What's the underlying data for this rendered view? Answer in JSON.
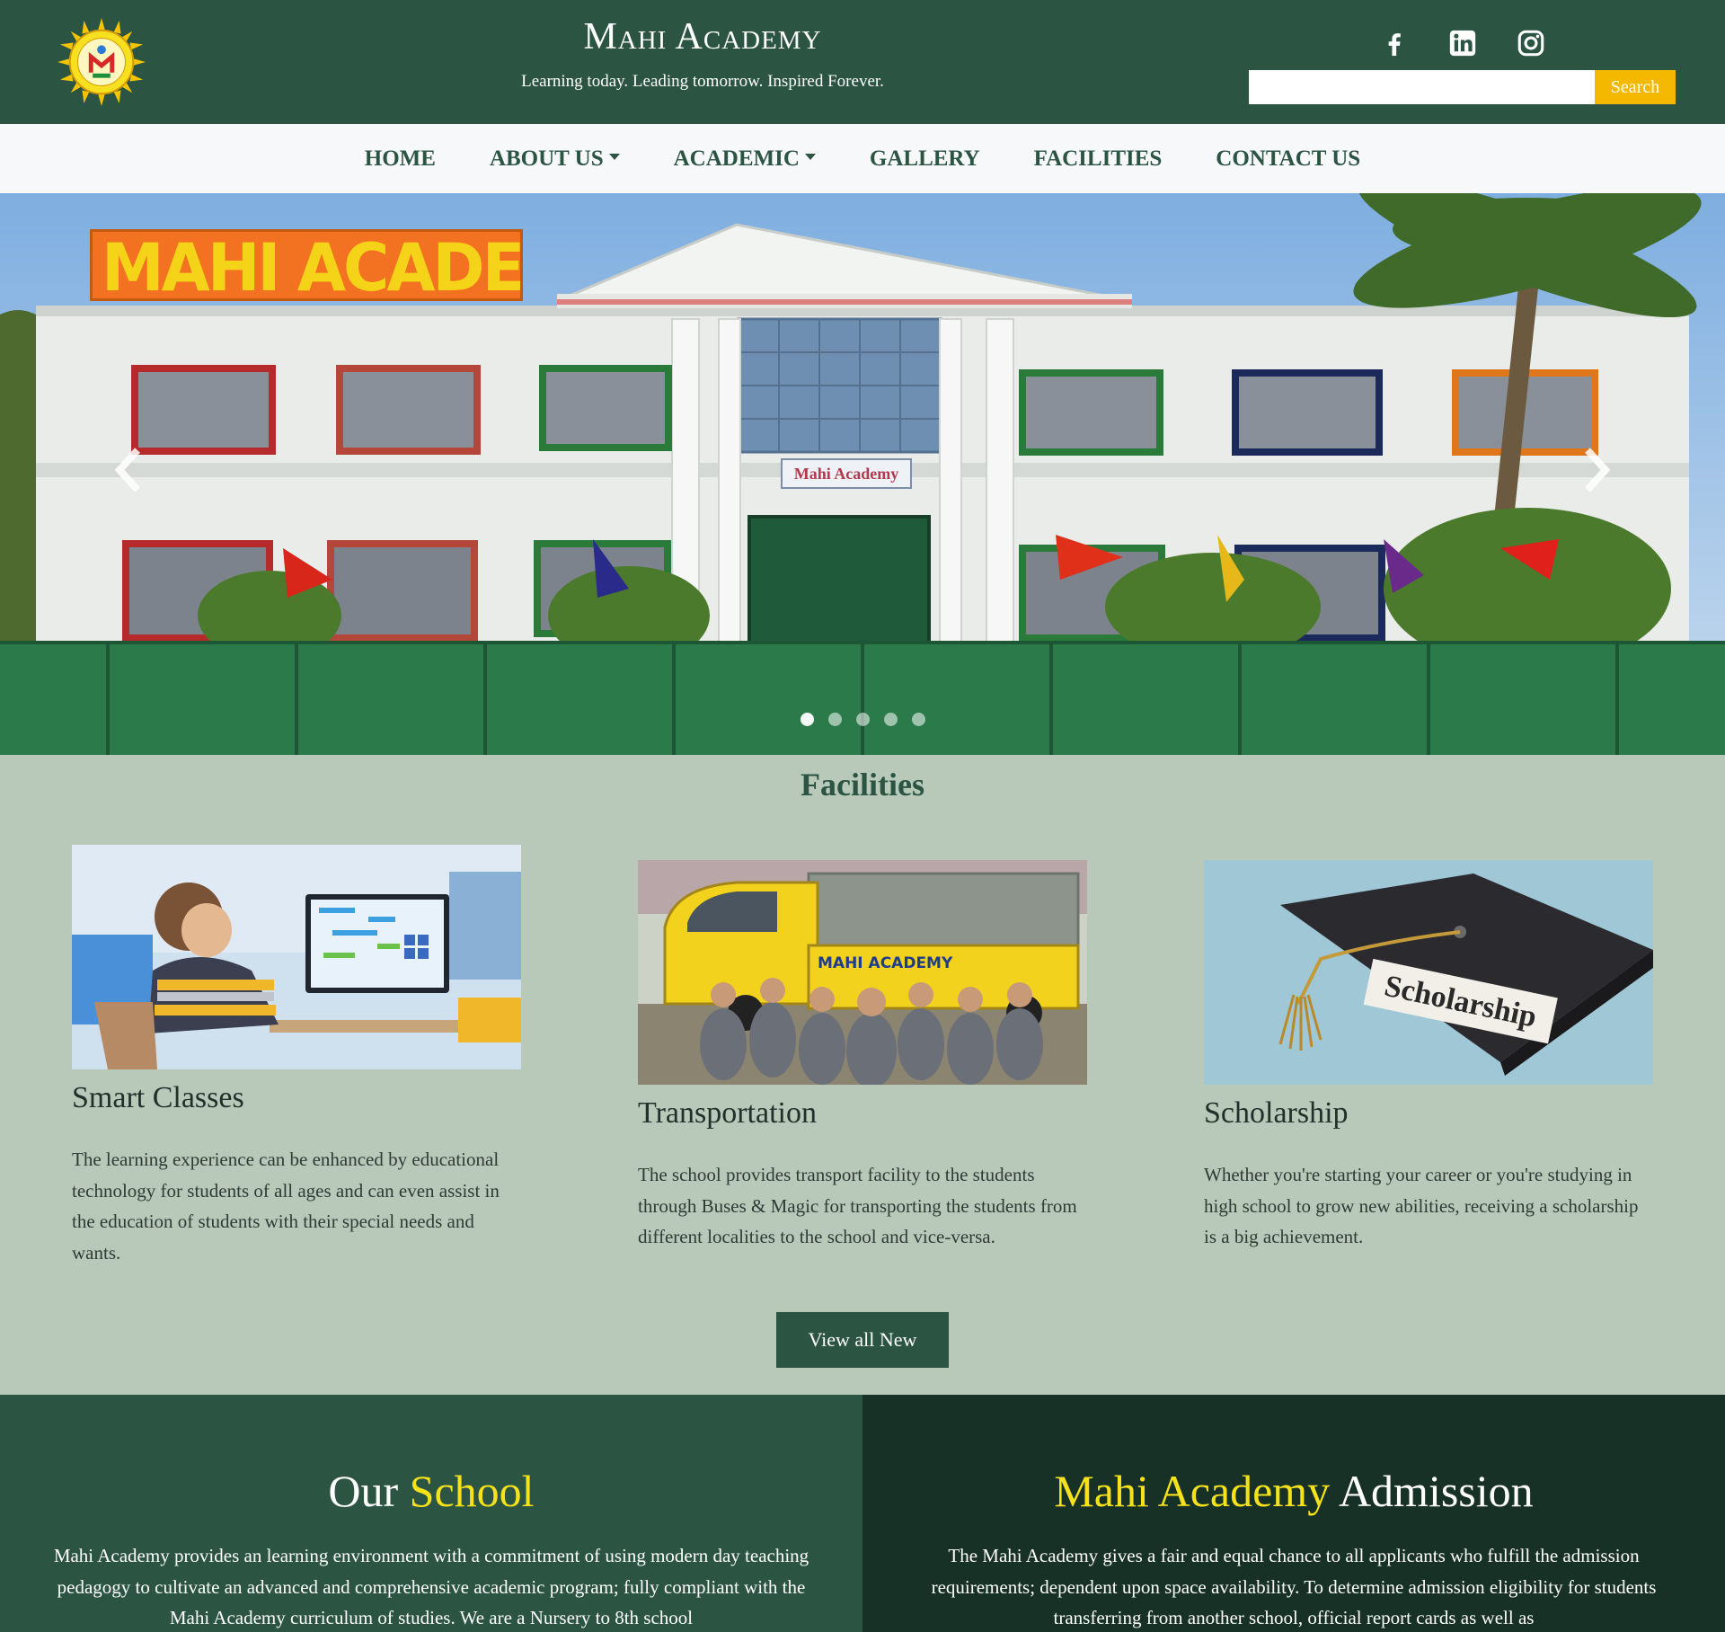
{
  "header": {
    "title": "Mahi Academy",
    "tagline": "Learning today. Leading tomorrow. Inspired Forever.",
    "logo_text": "MAHI ACADEMY",
    "socials": [
      {
        "icon": "facebook-icon"
      },
      {
        "icon": "linkedin-icon"
      },
      {
        "icon": "instagram-icon"
      }
    ],
    "search": {
      "placeholder": "",
      "button_label": "Search"
    }
  },
  "nav": {
    "items": [
      {
        "label": "HOME",
        "dropdown": false
      },
      {
        "label": "ABOUT US",
        "dropdown": true
      },
      {
        "label": "ACADEMIC",
        "dropdown": true
      },
      {
        "label": "GALLERY",
        "dropdown": false
      },
      {
        "label": "FACILITIES",
        "dropdown": false
      },
      {
        "label": "CONTACT US",
        "dropdown": false
      }
    ]
  },
  "hero": {
    "sign_text": "MAHI ACADEMY",
    "plate_text": "Mahi Academy",
    "slides_count": 5,
    "active_slide": 0
  },
  "facilities": {
    "title": "Facilities",
    "cards": [
      {
        "title": "Smart Classes",
        "text": "The learning experience can be enhanced by educational technology for students of all ages and can even assist in the education of students with their special needs and wants."
      },
      {
        "title": "Transportation",
        "text": "The school provides transport facility to the students through Buses & Magic for transporting the students from different localities to the school and vice-versa.",
        "image_text": "MAHI ACADEMY"
      },
      {
        "title": "Scholarship",
        "text": "Whether you're starting your career or you're studying in high school to grow new abilities, receiving a scholarship is a big achievement.",
        "image_text": "Scholarship"
      }
    ],
    "view_all_label": "View all New"
  },
  "our_school": {
    "title_plain": "Our ",
    "title_highlight": "School",
    "text": "Mahi Academy provides an learning environment with a commitment of using modern day teaching pedagogy to cultivate an advanced and comprehensive academic program; fully compliant with the Mahi Academy curriculum of studies. We are a Nursery to 8th school"
  },
  "admission": {
    "title_highlight": "Mahi Academy",
    "title_plain": " Admission",
    "text": "The Mahi Academy gives a fair and equal chance to all applicants who fulfill the admission requirements; dependent upon space availability. To determine admission eligibility for students transferring from another school, official report cards as well as"
  },
  "colors": {
    "primary_green": "#2b5443",
    "dark_green": "#173126",
    "page_bg": "#b8c8b9",
    "accent_yellow": "#f5b800",
    "highlight_yellow": "#f5e21b"
  }
}
